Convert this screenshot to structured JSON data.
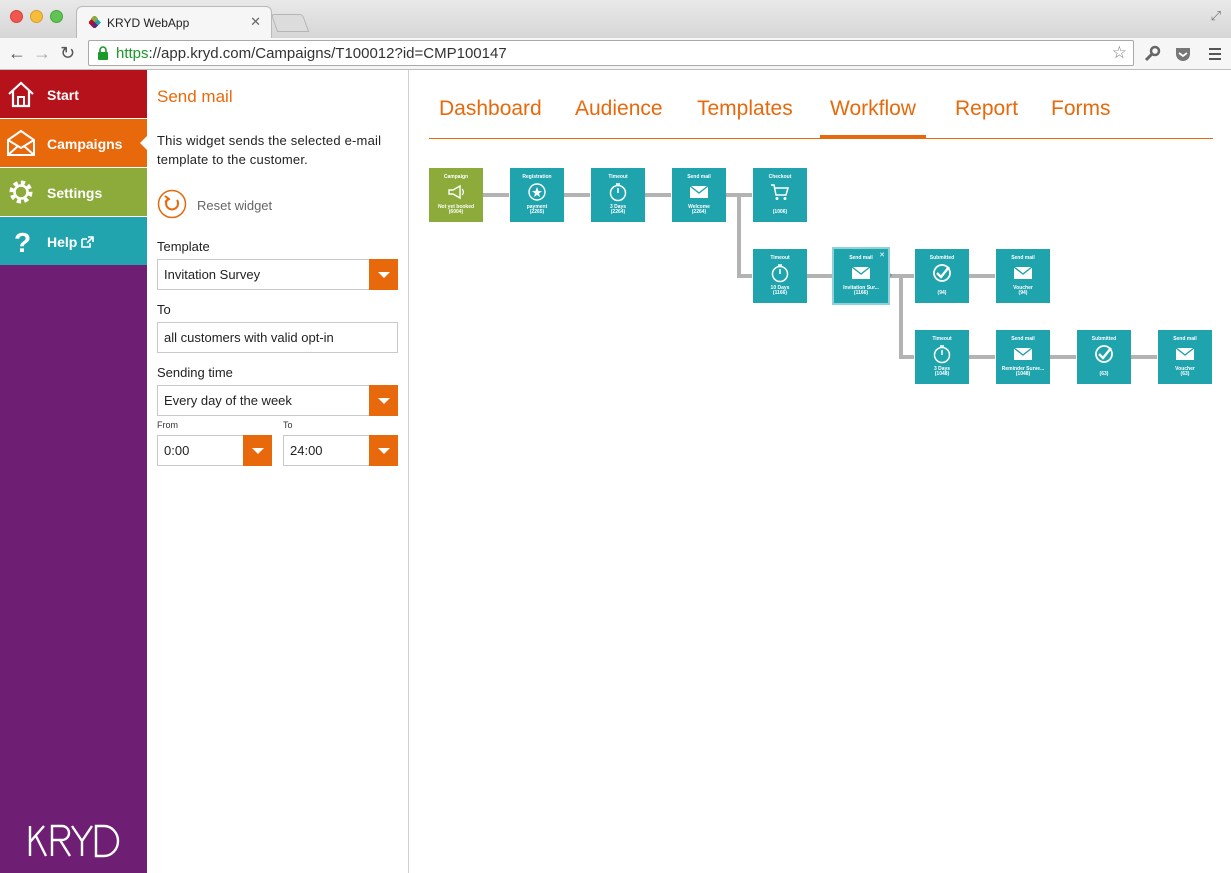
{
  "browser": {
    "tab_title": "KRYD WebApp",
    "url_scheme": "https",
    "url_rest": "://app.kryd.com/Campaigns/T100012?id=CMP100147"
  },
  "leftnav": {
    "items": [
      {
        "label": "Start",
        "icon": "house-icon",
        "color": "#b5121b"
      },
      {
        "label": "Campaigns",
        "icon": "envelope-icon",
        "color": "#e8690b"
      },
      {
        "label": "Settings",
        "icon": "gear-icon",
        "color": "#8cab3b"
      },
      {
        "label": "Help",
        "icon": "question-icon",
        "color": "#22a4ae"
      }
    ],
    "logo": "KRYD",
    "background": "#6e1f74"
  },
  "widget": {
    "title": "Send mail",
    "description": "This widget sends the selected e-mail template to the customer.",
    "reset_label": "Reset widget",
    "template_label": "Template",
    "template_value": "Invitation Survey",
    "to_label": "To",
    "to_value": "all customers with valid opt-in",
    "sending_time_label": "Sending time",
    "sending_time_value": "Every day of the week",
    "from_label": "From",
    "from_value": "0:00",
    "to_time_label": "To",
    "to_time_value": "24:00"
  },
  "main": {
    "tabs": [
      "Dashboard",
      "Audience",
      "Templates",
      "Workflow",
      "Report",
      "Forms"
    ],
    "active_tab": "Workflow",
    "accent": "#e8690b",
    "node_color": "#1fa3ad",
    "nodes": [
      {
        "title": "Campaign",
        "label": "Not yet booked",
        "count": "(6004)",
        "icon": "megaphone-icon"
      },
      {
        "title": "Registration",
        "label": "payment",
        "count": "(2265)",
        "icon": "badge-icon"
      },
      {
        "title": "Timeout",
        "label": "3 Days",
        "count": "(2264)",
        "icon": "stopwatch-icon"
      },
      {
        "title": "Send mail",
        "label": "Welcome",
        "count": "(2264)",
        "icon": "envelope-icon"
      },
      {
        "title": "Checkout",
        "label": "",
        "count": "(1006)",
        "icon": "cart-icon"
      },
      {
        "title": "Timeout",
        "label": "10 Days",
        "count": "(1166)",
        "icon": "stopwatch-icon"
      },
      {
        "title": "Send mail",
        "label": "Invitation Sur...",
        "count": "(1166)",
        "icon": "envelope-icon"
      },
      {
        "title": "Submitted",
        "label": "",
        "count": "(94)",
        "icon": "check-icon"
      },
      {
        "title": "Send mail",
        "label": "Voucher",
        "count": "(94)",
        "icon": "envelope-icon"
      },
      {
        "title": "Timeout",
        "label": "3 Days",
        "count": "(1048)",
        "icon": "stopwatch-icon"
      },
      {
        "title": "Send mail",
        "label": "Reminder Surve...",
        "count": "(1048)",
        "icon": "envelope-icon"
      },
      {
        "title": "Submitted",
        "label": "",
        "count": "(63)",
        "icon": "check-icon"
      },
      {
        "title": "Send mail",
        "label": "Voucher",
        "count": "(63)",
        "icon": "envelope-icon"
      }
    ]
  }
}
